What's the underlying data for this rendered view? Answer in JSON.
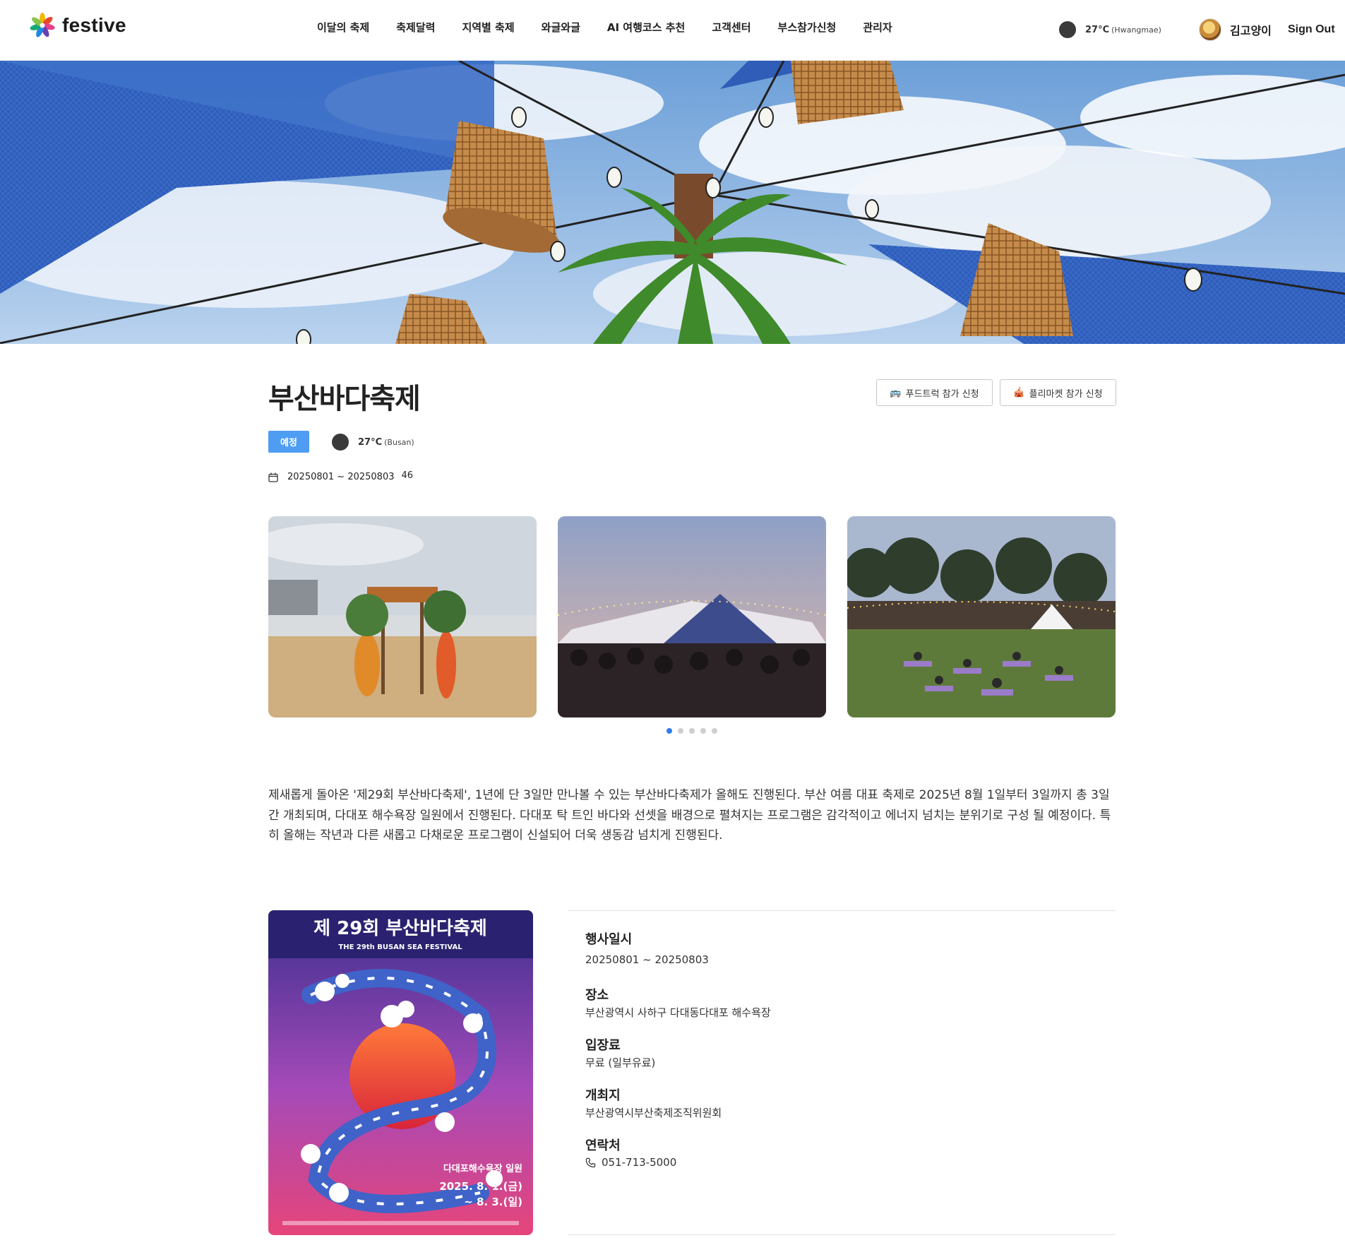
{
  "header": {
    "logo_text": "festive",
    "nav": [
      "이달의 축제",
      "축제달력",
      "지역별 축제",
      "와글와글",
      "AI 여행코스 추천",
      "고객센터",
      "부스참가신청",
      "관리자"
    ],
    "weather": {
      "temp": "27°C",
      "location": "(Hwangmae)"
    },
    "user_name": "김고양이",
    "signout_label": "Sign Out"
  },
  "festival": {
    "title": "부산바다축제",
    "status_badge": "예정",
    "weather": {
      "temp": "27°C",
      "location": "(Busan)"
    },
    "date_range": "20250801 ~ 20250803",
    "views": "46",
    "apply_buttons": [
      {
        "icon": "🚌",
        "label": "푸드트럭 참가 신청"
      },
      {
        "icon": "🎪",
        "label": "플리마켓 참가 신청"
      }
    ],
    "description": "제새롭게 돌아온 '제29회 부산바다축제', 1년에 단 3일만 만나볼 수 있는 부산바다축제가 올해도 진행된다. 부산 여름 대표 축제로 2025년 8월 1일부터 3일까지 총 3일간 개최되며, 다대포 해수욕장 일원에서 진행된다. 다대포 탁 트인 바다와 선셋을 배경으로 펼쳐지는 프로그램은 감각적이고 에너지 넘치는 분위기로 구성 될 예정이다. 특히 올해는 작년과 다른 새롭고 다채로운 프로그램이 신설되어 더욱 생동감 넘치게 진행된다."
  },
  "gallery": {
    "dot_count": 5,
    "active_index": 0
  },
  "poster": {
    "title_ko": "제 29회 부산바다축제",
    "title_en": "THE 29th BUSAN SEA FESTIVAL",
    "venue": "다대포해수욕장 일원",
    "date_line1": "2025. 8. 1.(금)",
    "date_line2": "~ 8. 3.(일)"
  },
  "info": {
    "items": [
      {
        "label": "행사일시",
        "value": "20250801 ~ 20250803"
      },
      {
        "label": "장소",
        "value": "부산광역시 사하구 다대동다대포 해수욕장"
      },
      {
        "label": "입장료",
        "value": "무료 (일부유료)"
      },
      {
        "label": "개최지",
        "value": "부산광역시부산축제조직위원회"
      },
      {
        "label": "연락처",
        "value": "051-713-5000"
      }
    ]
  },
  "colors": {
    "accent": "#4f9cf3",
    "dot_active": "#2f7cf2"
  }
}
